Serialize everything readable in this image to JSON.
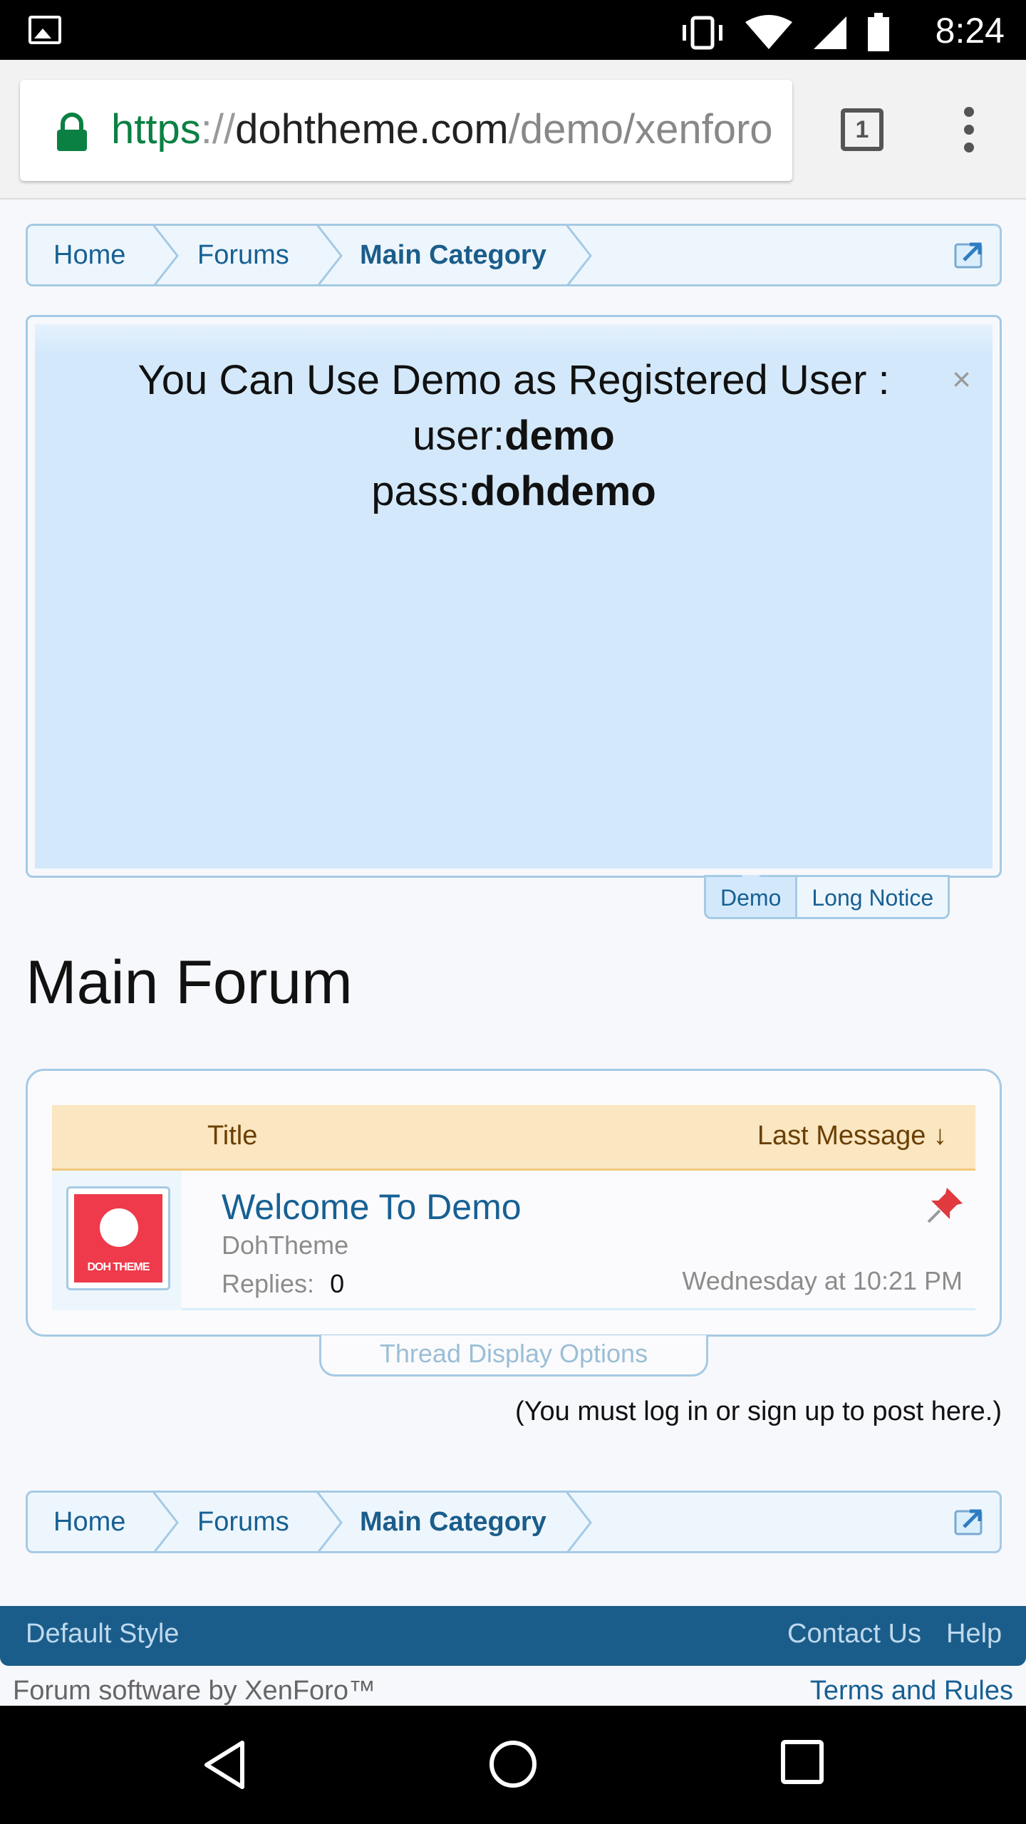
{
  "status_bar": {
    "time": "8:24",
    "icons": [
      "image-icon",
      "vibrate-icon",
      "wifi-icon",
      "signal-icon",
      "battery-icon"
    ]
  },
  "browser": {
    "url_scheme": "https",
    "url_sep": "://",
    "url_host": "dohtheme.com",
    "url_path": "/demo/xenforo",
    "tab_count": "1"
  },
  "breadcrumb": {
    "items": [
      "Home",
      "Forums",
      "Main Category"
    ]
  },
  "notice": {
    "line1": "You Can Use Demo as Registered User :",
    "user_label": "user:",
    "user_value": "demo",
    "pass_label": "pass:",
    "pass_value": "dohdemo",
    "close": "×",
    "tabs": [
      "Demo",
      "Long Notice"
    ]
  },
  "page_title": "Main Forum",
  "thread_list": {
    "col_title": "Title",
    "col_last": "Last Message ↓",
    "rows": [
      {
        "title": "Welcome To Demo",
        "author": "DohTheme",
        "replies_label": "Replies:",
        "replies": "0",
        "last_date": "Wednesday at 10:21 PM",
        "avatar_text": "DOH THEME"
      }
    ]
  },
  "thread_display_options": "Thread Display Options",
  "must_login": "(You must log in or sign up to post here.)",
  "footer": {
    "style": "Default Style",
    "contact": "Contact Us",
    "help": "Help",
    "software": "Forum software by XenForo™",
    "terms": "Terms and Rules"
  },
  "colors": {
    "accent": "#176093",
    "footer_bg": "#1b5d8a",
    "notice_bg": "#d3e9fb",
    "table_header_bg": "#fae6c1"
  }
}
